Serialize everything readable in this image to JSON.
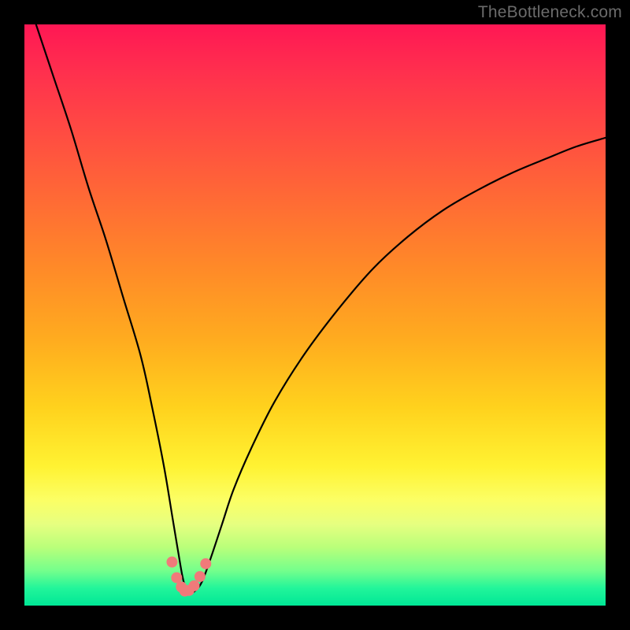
{
  "watermark": "TheBottleneck.com",
  "chart_data": {
    "type": "line",
    "title": "",
    "xlabel": "",
    "ylabel": "",
    "xlim": [
      0,
      100
    ],
    "ylim": [
      0,
      100
    ],
    "x": [
      2,
      5,
      8,
      11,
      14,
      17,
      20,
      22,
      24,
      25.5,
      26.5,
      27.2,
      27.8,
      28.3,
      29.2,
      30.5,
      32,
      34,
      36,
      39,
      43,
      48,
      54,
      60,
      66,
      72,
      78,
      84,
      90,
      95,
      100
    ],
    "y": [
      100,
      91,
      82,
      72,
      63,
      53,
      43,
      34,
      24,
      15,
      9,
      5,
      2.8,
      2.2,
      2.4,
      4,
      8,
      14,
      20,
      27,
      35,
      43,
      51,
      58,
      63.5,
      68,
      71.5,
      74.5,
      77,
      79,
      80.5
    ],
    "markers": {
      "x": [
        25.4,
        26.2,
        27.0,
        27.6,
        28.3,
        29.2,
        30.2,
        31.2
      ],
      "y": [
        7.5,
        4.8,
        3.2,
        2.5,
        2.6,
        3.4,
        5.0,
        7.2
      ],
      "color": "#f07a7a"
    },
    "curve_color": "#000000",
    "background_gradient": [
      "#ff1754",
      "#ff8a28",
      "#fff232",
      "#00e796"
    ]
  }
}
